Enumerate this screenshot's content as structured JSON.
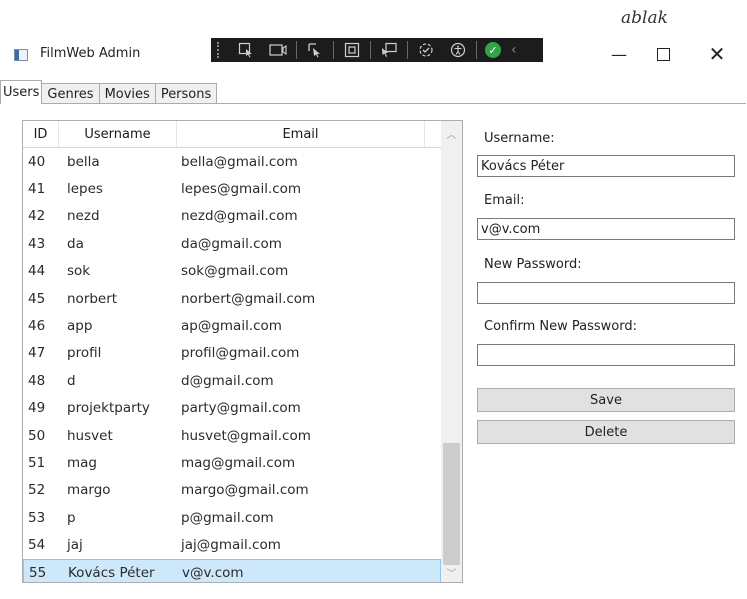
{
  "caption": "ablak",
  "window": {
    "title": "FilmWeb Admin",
    "minimize": "—",
    "close": "✕"
  },
  "devtools": {
    "icons": [
      "select-element-icon",
      "display-layout-icon",
      "track-focus-icon",
      "binding-icon",
      "hot-reload-icon",
      "accessibility-icon",
      "success-icon"
    ]
  },
  "tabs": [
    "Users",
    "Genres",
    "Movies",
    "Persons"
  ],
  "grid": {
    "columns": [
      "ID",
      "Username",
      "Email"
    ],
    "rows": [
      {
        "id": "40",
        "username": "bella",
        "email": "bella@gmail.com"
      },
      {
        "id": "41",
        "username": "lepes",
        "email": "lepes@gmail.com"
      },
      {
        "id": "42",
        "username": "nezd",
        "email": "nezd@gmail.com"
      },
      {
        "id": "43",
        "username": "da",
        "email": "da@gmail.com"
      },
      {
        "id": "44",
        "username": "sok",
        "email": "sok@gmail.com"
      },
      {
        "id": "45",
        "username": "norbert",
        "email": "norbert@gmail.com"
      },
      {
        "id": "46",
        "username": "app",
        "email": "ap@gmail.com"
      },
      {
        "id": "47",
        "username": "profil",
        "email": "profil@gmail.com"
      },
      {
        "id": "48",
        "username": "d",
        "email": "d@gmail.com"
      },
      {
        "id": "49",
        "username": "projektparty",
        "email": "party@gmail.com"
      },
      {
        "id": "50",
        "username": "husvet",
        "email": "husvet@gmail.com"
      },
      {
        "id": "51",
        "username": "mag",
        "email": "mag@gmail.com"
      },
      {
        "id": "52",
        "username": "margo",
        "email": "margo@gmail.com"
      },
      {
        "id": "53",
        "username": "p",
        "email": "p@gmail.com"
      },
      {
        "id": "54",
        "username": "jaj",
        "email": "jaj@gmail.com"
      },
      {
        "id": "55",
        "username": "Kovács Péter",
        "email": "v@v.com",
        "selected": true
      }
    ]
  },
  "form": {
    "username_label": "Username:",
    "username_value": "Kovács Péter",
    "email_label": "Email:",
    "email_value": "v@v.com",
    "new_password_label": "New Password:",
    "new_password_value": "",
    "confirm_password_label": "Confirm New Password:",
    "confirm_password_value": "",
    "save_label": "Save",
    "delete_label": "Delete"
  },
  "colors": {
    "selection": "#cde8fb",
    "button_face": "#e1e1e1",
    "devbar": "#1c1c1c",
    "success": "#31a44a"
  }
}
